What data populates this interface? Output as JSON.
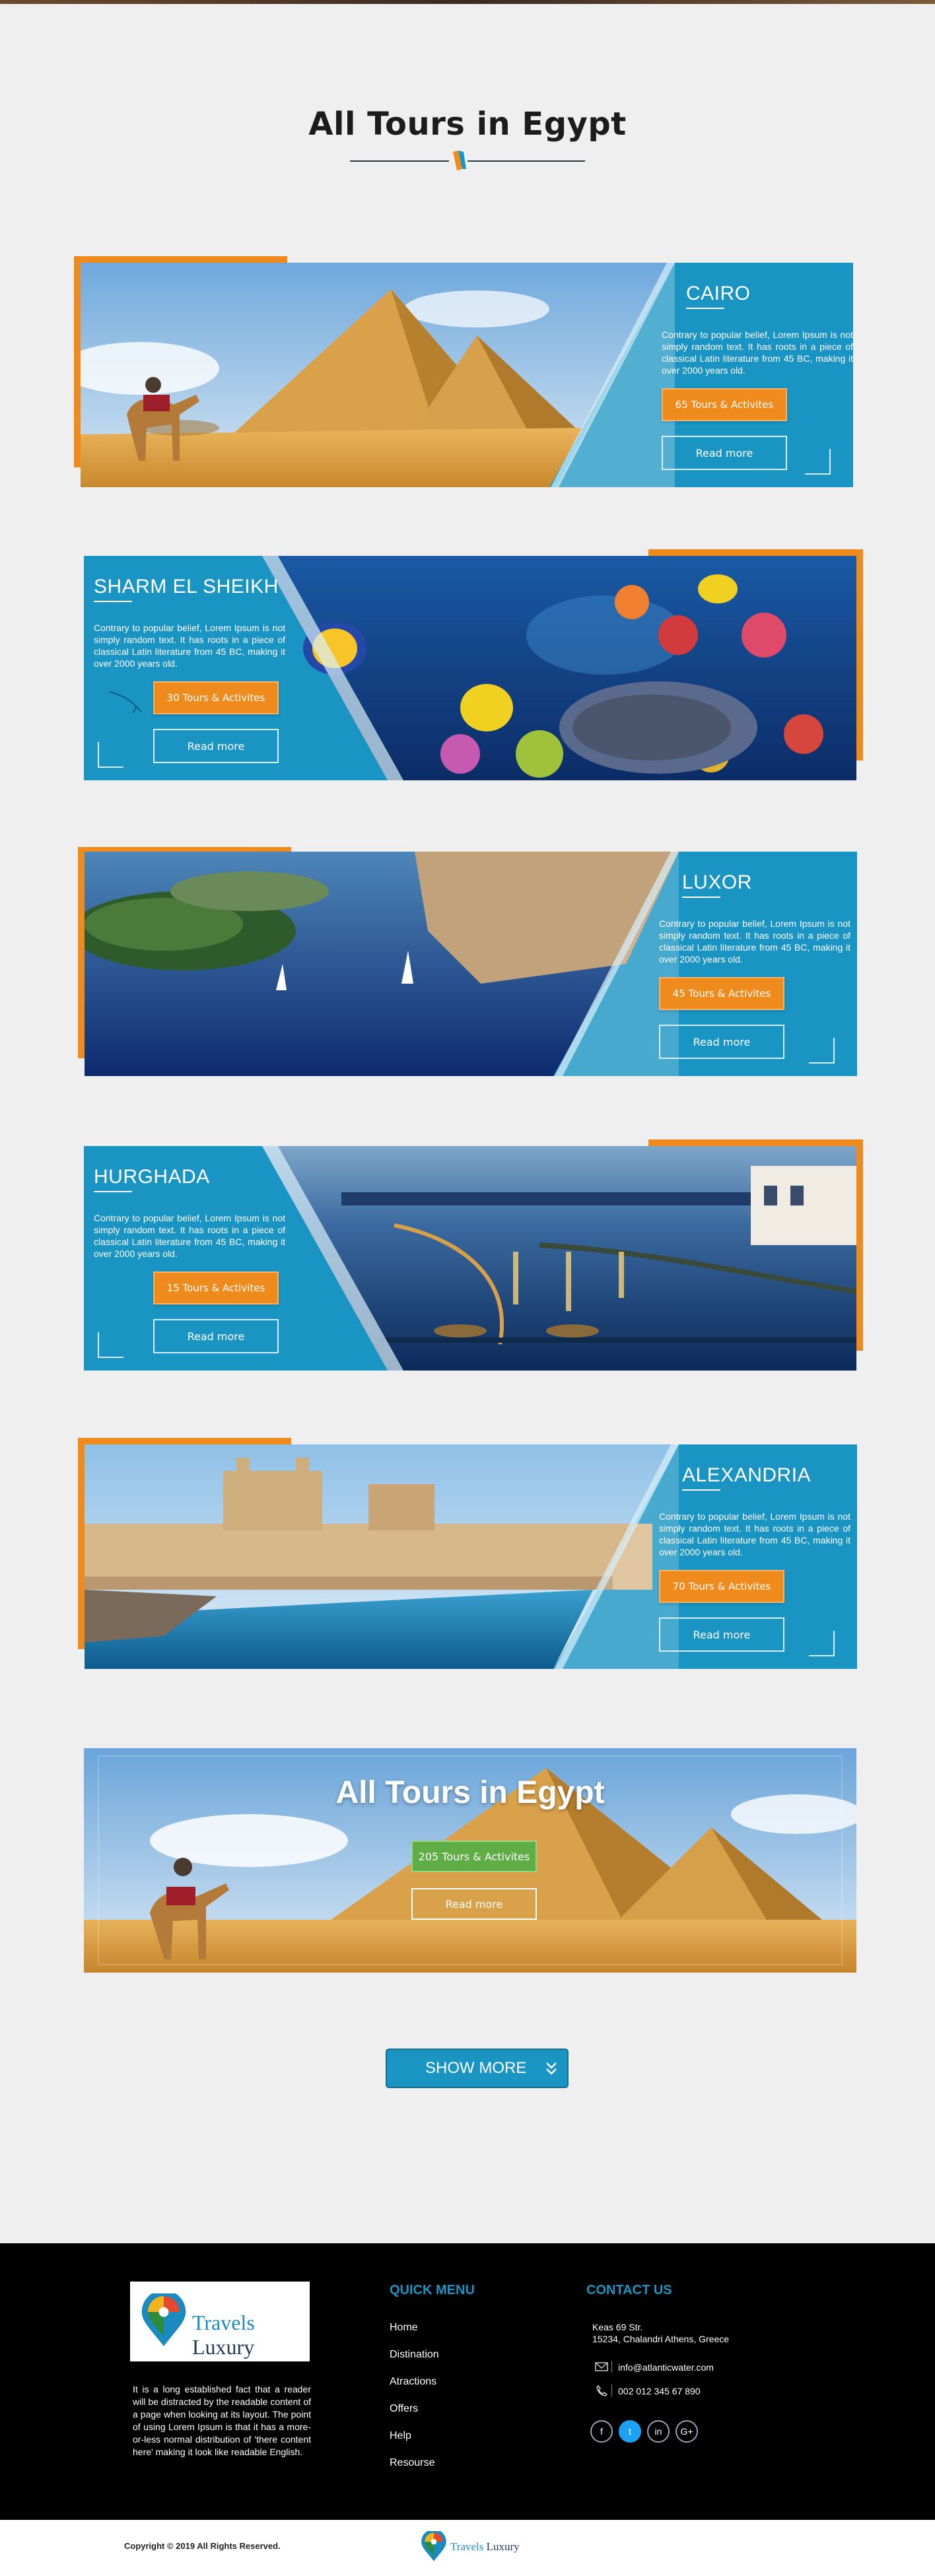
{
  "page_title": "All Tours in Egypt",
  "tours": [
    {
      "city": "CAIRO",
      "description": "Contrary to popular belief, Lorem Ipsum is not simply random text. It has roots in a piece of classical Latin literature from 45 BC, making it over 2000 years old.",
      "tours_label": "65 Tours & Activites",
      "read_more": "Read more"
    },
    {
      "city": "SHARM EL SHEIKH",
      "description": "Contrary to popular belief, Lorem Ipsum is not simply random text. It has roots in a piece of classical Latin literature from 45 BC, making it over 2000 years old.",
      "tours_label": "30 Tours & Activites",
      "read_more": "Read more"
    },
    {
      "city": "LUXOR",
      "description": "Contrary to popular belief, Lorem Ipsum is not simply random text. It has roots in a piece of classical Latin literature from 45 BC, making it over 2000 years old.",
      "tours_label": "45 Tours & Activites",
      "read_more": "Read more"
    },
    {
      "city": "HURGHADA",
      "description": "Contrary to popular belief, Lorem Ipsum is not simply random text. It has roots in a piece of classical Latin literature from 45 BC, making it over 2000 years old.",
      "tours_label": "15 Tours & Activites",
      "read_more": "Read more"
    },
    {
      "city": "ALEXANDRIA",
      "description": "Contrary to popular belief, Lorem Ipsum is not simply random text. It has roots in a piece of classical Latin literature from 45 BC, making it over 2000 years old.",
      "tours_label": "70 Tours & Activites",
      "read_more": "Read more"
    }
  ],
  "banner": {
    "title": "All Tours in Egypt",
    "tours_label": "205 Tours & Activites",
    "read_more": "Read more"
  },
  "show_more": "SHOW MORE",
  "footer": {
    "logo": {
      "word1": "Travels",
      "word2": "Luxury"
    },
    "about": "It is a long established fact that a reader will be distracted by the readable content of a page when looking at its layout. The point of using Lorem Ipsum is that it has a more-or-less normal distribution of 'there content here' making it look like readable English.",
    "quick_menu_title": "QUICK MENU",
    "menu": [
      "Home",
      "Distination",
      "Atractions",
      "Offers",
      "Help",
      "Resourse"
    ],
    "contact_title": "CONTACT US",
    "address_line1": "Keas 69 Str.",
    "address_line2": "15234, Chalandri Athens, Greece",
    "email": "info@atlanticwater.com",
    "phone": "002 012 345 67 890",
    "social": [
      "f",
      "t",
      "in",
      "G+"
    ],
    "copyright": "Copyright © 2019 All Rights Reserved."
  },
  "colors": {
    "accent_orange": "#ef8a1d",
    "panel_blue": "#1a94c2",
    "button_green": "#5fae45",
    "footer_bg": "#000000"
  },
  "icons": [
    "envelope-icon",
    "phone-icon",
    "facebook-icon",
    "twitter-icon",
    "linkedin-icon",
    "google-plus-icon",
    "double-chevron-down-icon",
    "corner-bracket-icon",
    "dolphin-icon"
  ]
}
